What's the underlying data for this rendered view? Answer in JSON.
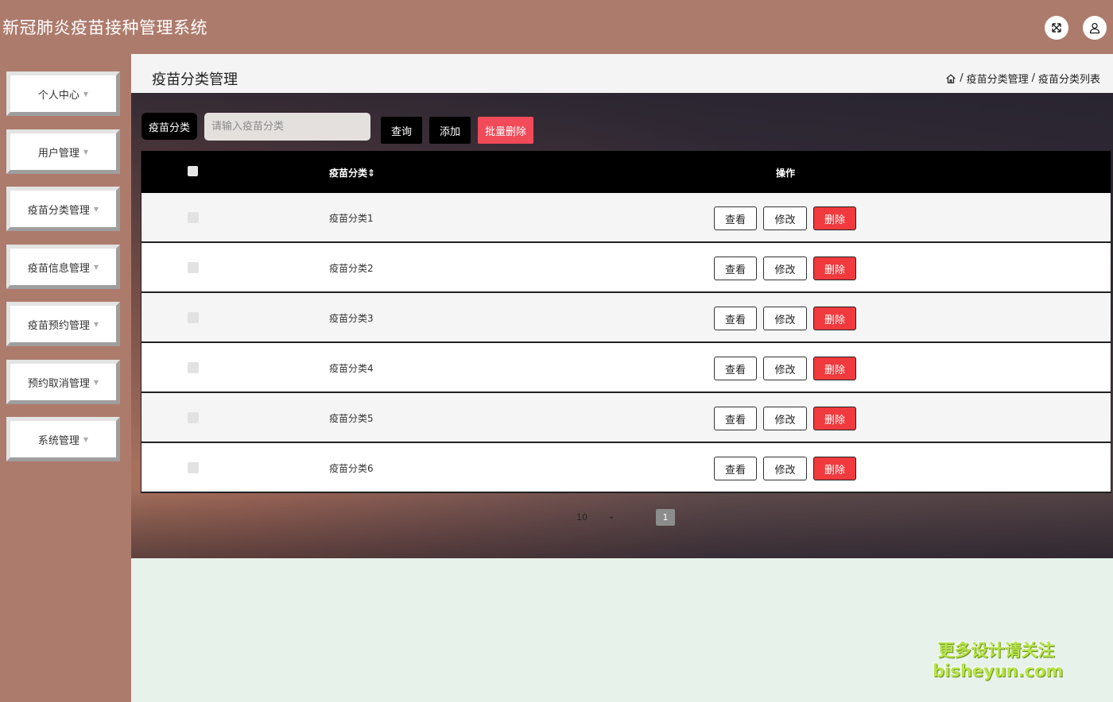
{
  "app": {
    "title": "新冠肺炎疫苗接种管理系统"
  },
  "header": {
    "fullscreen_icon": "expand-arrows-icon",
    "user_icon": "user-icon"
  },
  "sidebar": {
    "items": [
      {
        "label": "个人中心"
      },
      {
        "label": "用户管理"
      },
      {
        "label": "疫苗分类管理"
      },
      {
        "label": "疫苗信息管理"
      },
      {
        "label": "疫苗预约管理"
      },
      {
        "label": "预约取消管理"
      },
      {
        "label": "系统管理"
      }
    ]
  },
  "page": {
    "title": "疫苗分类管理",
    "breadcrumb": [
      "疫苗分类管理",
      "疫苗分类列表"
    ],
    "breadcrumb_sep": "/"
  },
  "search": {
    "label": "疫苗分类",
    "placeholder": "请输入疫苗分类",
    "query_button": "查询",
    "add_button": "添加",
    "batch_delete_button": "批量删除"
  },
  "table": {
    "headers": {
      "name": "疫苗分类",
      "sort_icon": "⇕",
      "actions": "操作"
    },
    "actions": {
      "view": "查看",
      "edit": "修改",
      "delete": "删除"
    },
    "rows": [
      {
        "name": "疫苗分类1"
      },
      {
        "name": "疫苗分类2"
      },
      {
        "name": "疫苗分类3"
      },
      {
        "name": "疫苗分类4"
      },
      {
        "name": "疫苗分类5"
      },
      {
        "name": "疫苗分类6"
      }
    ]
  },
  "pagination": {
    "page_size": "10",
    "current_page": "1"
  },
  "watermark": {
    "line1": "更多设计请关注",
    "line2": "bisheyun.com"
  },
  "colors": {
    "header_bg": "#ad7b6c",
    "danger": "#f03a3e",
    "batch_delete": "#f14a59",
    "watermark": "#b6e44a"
  }
}
